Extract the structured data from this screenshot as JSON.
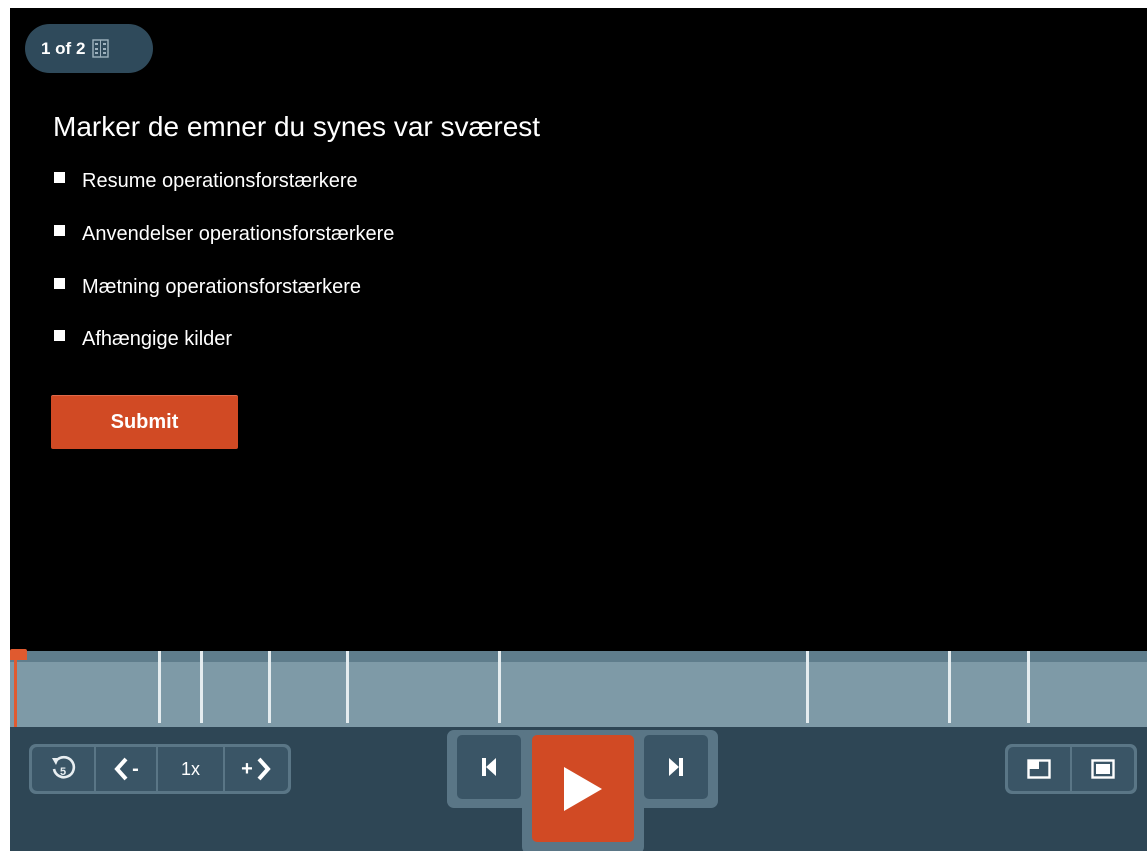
{
  "quiz": {
    "counter": "1 of 2",
    "question": "Marker de emner du synes var sværest",
    "options": [
      {
        "label": "Resume operationsforstærkere",
        "checked": false
      },
      {
        "label": "Anvendelser operationsforstærkere",
        "checked": false
      },
      {
        "label": "Mætning operationsforstærkere",
        "checked": false
      },
      {
        "label": "Afhængige kilder",
        "checked": false
      }
    ],
    "submit_label": "Submit"
  },
  "timeline": {
    "progress": 0.0
  },
  "controls": {
    "speed_label": "1x",
    "slower_label": "-",
    "faster_label": "+",
    "replay_icon": "rewind-5-icon",
    "prev_icon": "skip-back-icon",
    "play_icon": "play-icon",
    "next_icon": "skip-forward-icon",
    "window_icon": "picture-in-picture-icon",
    "fullscreen_icon": "fullscreen-icon"
  },
  "colors": {
    "accent": "#d14a24",
    "bar": "#2e4655",
    "timeline": "#7e9aa7",
    "playhead": "#e05a2f"
  }
}
